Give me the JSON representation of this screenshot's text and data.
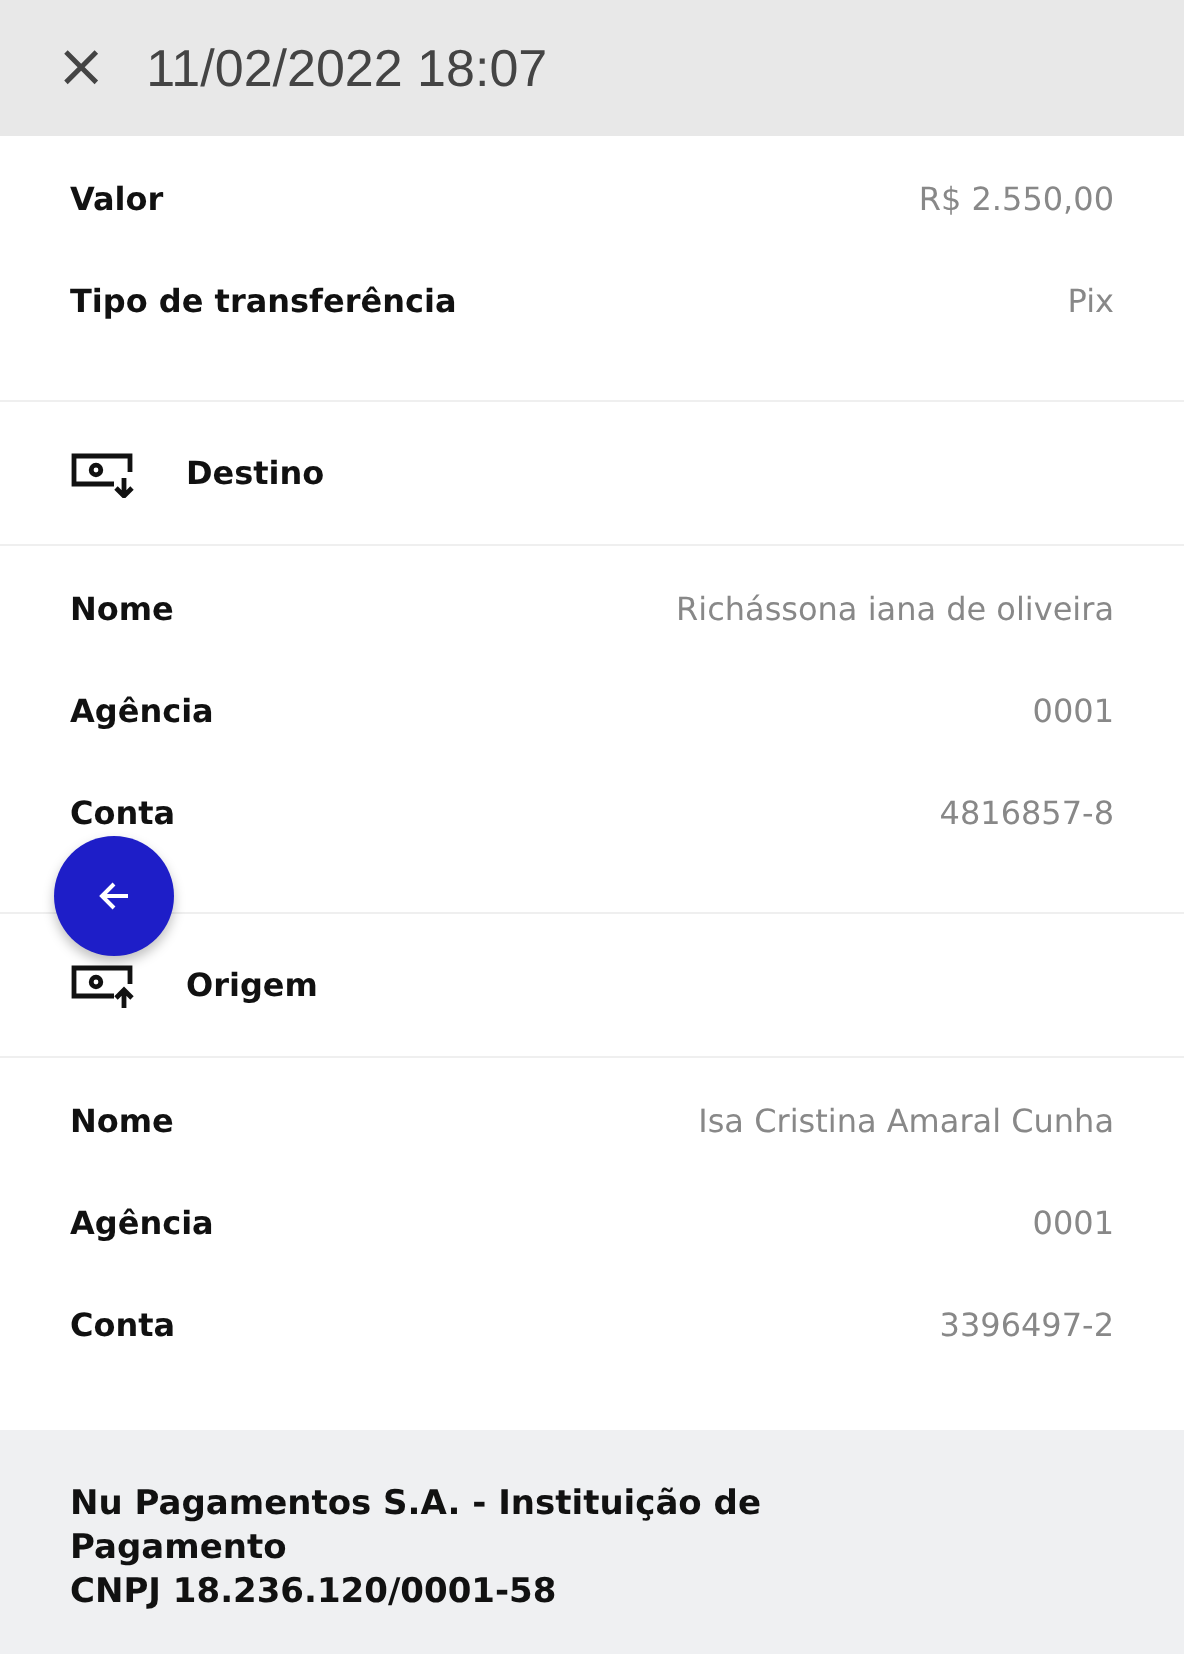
{
  "header": {
    "close_symbol": "×",
    "title": "11/02/2022 18:07"
  },
  "summary": [
    {
      "label": "Valor",
      "value": "R$ 2.550,00"
    },
    {
      "label": "Tipo de transferência",
      "value": "Pix"
    }
  ],
  "parties": [
    {
      "title": "Destino",
      "kind": "incoming",
      "rows": [
        {
          "label": "Nome",
          "value": "Richássona iana de oliveira"
        },
        {
          "label": "Agência",
          "value": "0001"
        },
        {
          "label": "Conta",
          "value": "4816857-8"
        }
      ]
    },
    {
      "title": "Origem",
      "kind": "outgoing",
      "rows": [
        {
          "label": "Nome",
          "value": "Isa Cristina Amaral Cunha"
        },
        {
          "label": "Agência",
          "value": "0001"
        },
        {
          "label": "Conta",
          "value": "3396497-2"
        }
      ]
    }
  ],
  "footer": {
    "lines": [
      "Nu Pagamentos S.A. - Instituição de Pagamento",
      "CNPJ 18.236.120/0001-58"
    ]
  }
}
